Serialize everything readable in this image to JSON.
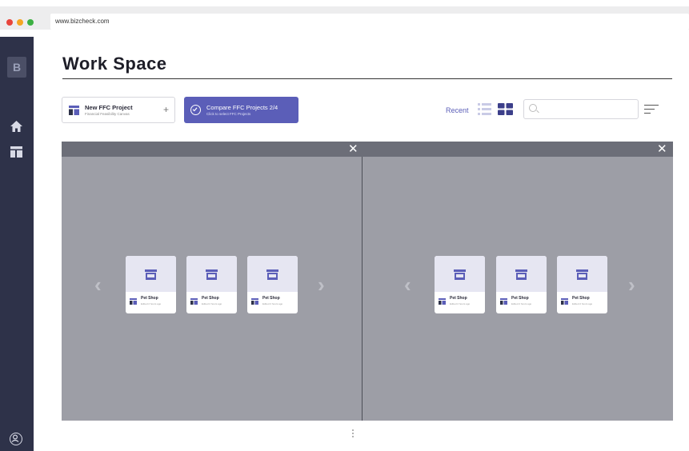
{
  "browser": {
    "url": "www.bizcheck.com",
    "dots": [
      "#e8453c",
      "#f5a623",
      "#3cb043"
    ]
  },
  "sidebar": {
    "logo": "B",
    "icons": [
      "home-icon",
      "dashboard-icon",
      "profile-icon"
    ]
  },
  "page": {
    "title": "Work Space"
  },
  "toolbar": {
    "new_project": {
      "label": "New FFC Project",
      "sublabel": "Financial Feasibility Canvas",
      "plus": "+"
    },
    "compare": {
      "label": "Compare FFC Projects 2/4",
      "sublabel": "Click to select FFC Projects"
    },
    "recent_label": "Recent",
    "search_placeholder": ""
  },
  "overlay": {
    "close_symbol": "✕",
    "left_panel": {
      "cards": [
        {
          "name": "Pet Shop",
          "edited": "Edited 2 hours ago"
        },
        {
          "name": "Pet Shop",
          "edited": "Edited 2 hours ago"
        },
        {
          "name": "Pet Shop",
          "edited": "Edited 2 hours ago"
        }
      ]
    },
    "right_panel": {
      "cards": [
        {
          "name": "Pet Shop",
          "edited": "Edited 2 hours ago"
        },
        {
          "name": "Pet Shop",
          "edited": "Edited 2 hours ago"
        },
        {
          "name": "Pet Shop",
          "edited": "Edited 2 hours ago"
        }
      ]
    },
    "prev_arrow": "‹",
    "next_arrow": "›"
  },
  "colors": {
    "accent": "#5b5eb8",
    "sidebar": "#2e3249",
    "overlay": "#9d9ea6",
    "overlay_header": "#6c6e78"
  }
}
